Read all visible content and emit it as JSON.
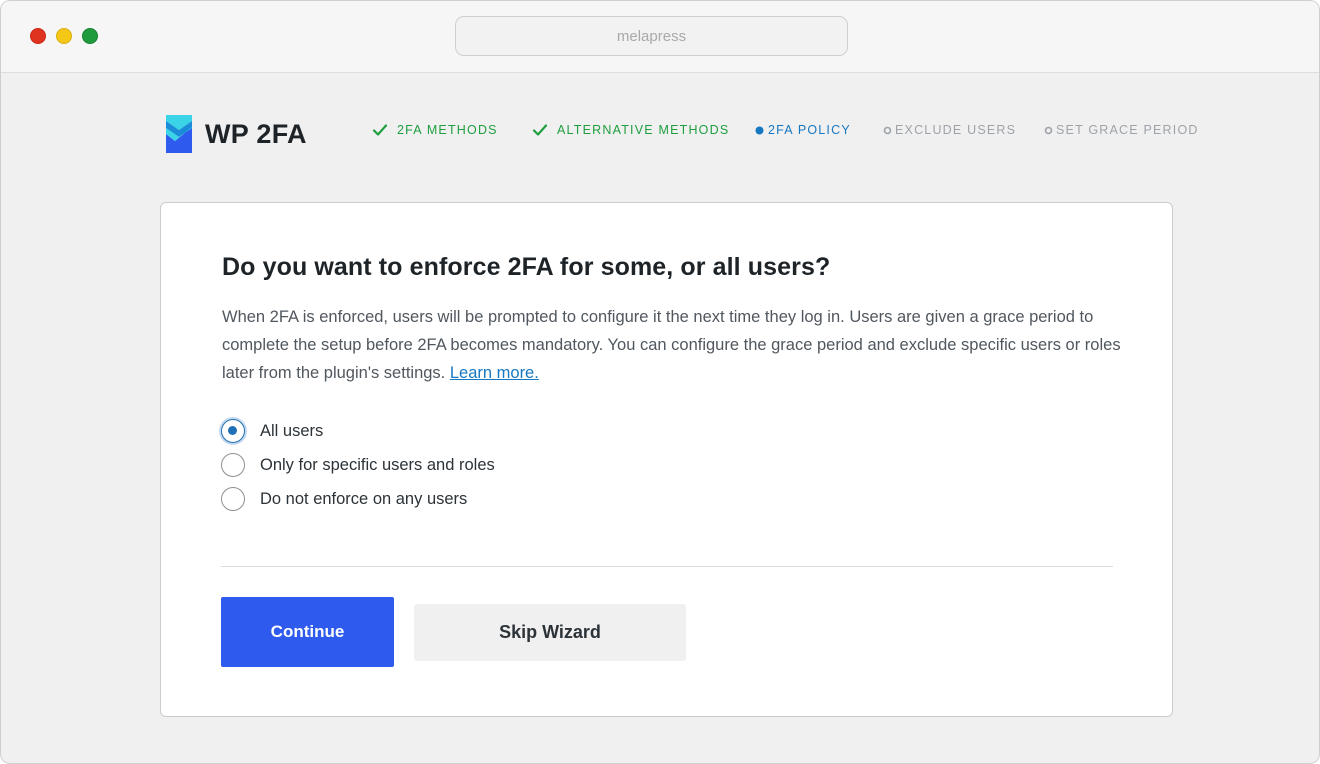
{
  "browser": {
    "address_text": "melapress"
  },
  "brand": {
    "logo_text": "WP 2FA",
    "logo_colors": [
      "#3bd3e8",
      "#1a8cd8",
      "#2e5bee"
    ]
  },
  "wizard_steps": [
    {
      "label": "2FA METHODS",
      "state": "done",
      "icon": "check-icon"
    },
    {
      "label": "ALTERNATIVE METHODS",
      "state": "done",
      "icon": "check-icon"
    },
    {
      "label": "2FA POLICY",
      "state": "current",
      "icon": "filled-dot-icon"
    },
    {
      "label": "EXCLUDE USERS",
      "state": "todo",
      "icon": "ring-icon"
    },
    {
      "label": "SET GRACE PERIOD",
      "state": "todo",
      "icon": "ring-icon"
    }
  ],
  "card": {
    "heading": "Do you want to enforce 2FA for some, or all users?",
    "description": "When 2FA is enforced, users will be prompted to configure it the next time they log in. Users are given a grace period to complete the setup before 2FA becomes mandatory. You can configure the grace period and exclude specific users or roles later from the plugin's settings.",
    "learn_more_link": "Learn more.",
    "options": [
      {
        "label": "All users",
        "checked": true
      },
      {
        "label": "Only for specific users and roles",
        "checked": false
      },
      {
        "label": "Do not enforce on any users",
        "checked": false
      }
    ],
    "continue_label": "Continue",
    "skip_label": "Skip Wizard"
  },
  "colors": {
    "done": "#1e9e3e",
    "current": "#1778c2",
    "todo": "#9ea3a8",
    "primary_button": "#2e5bee",
    "link": "#1778c2"
  }
}
